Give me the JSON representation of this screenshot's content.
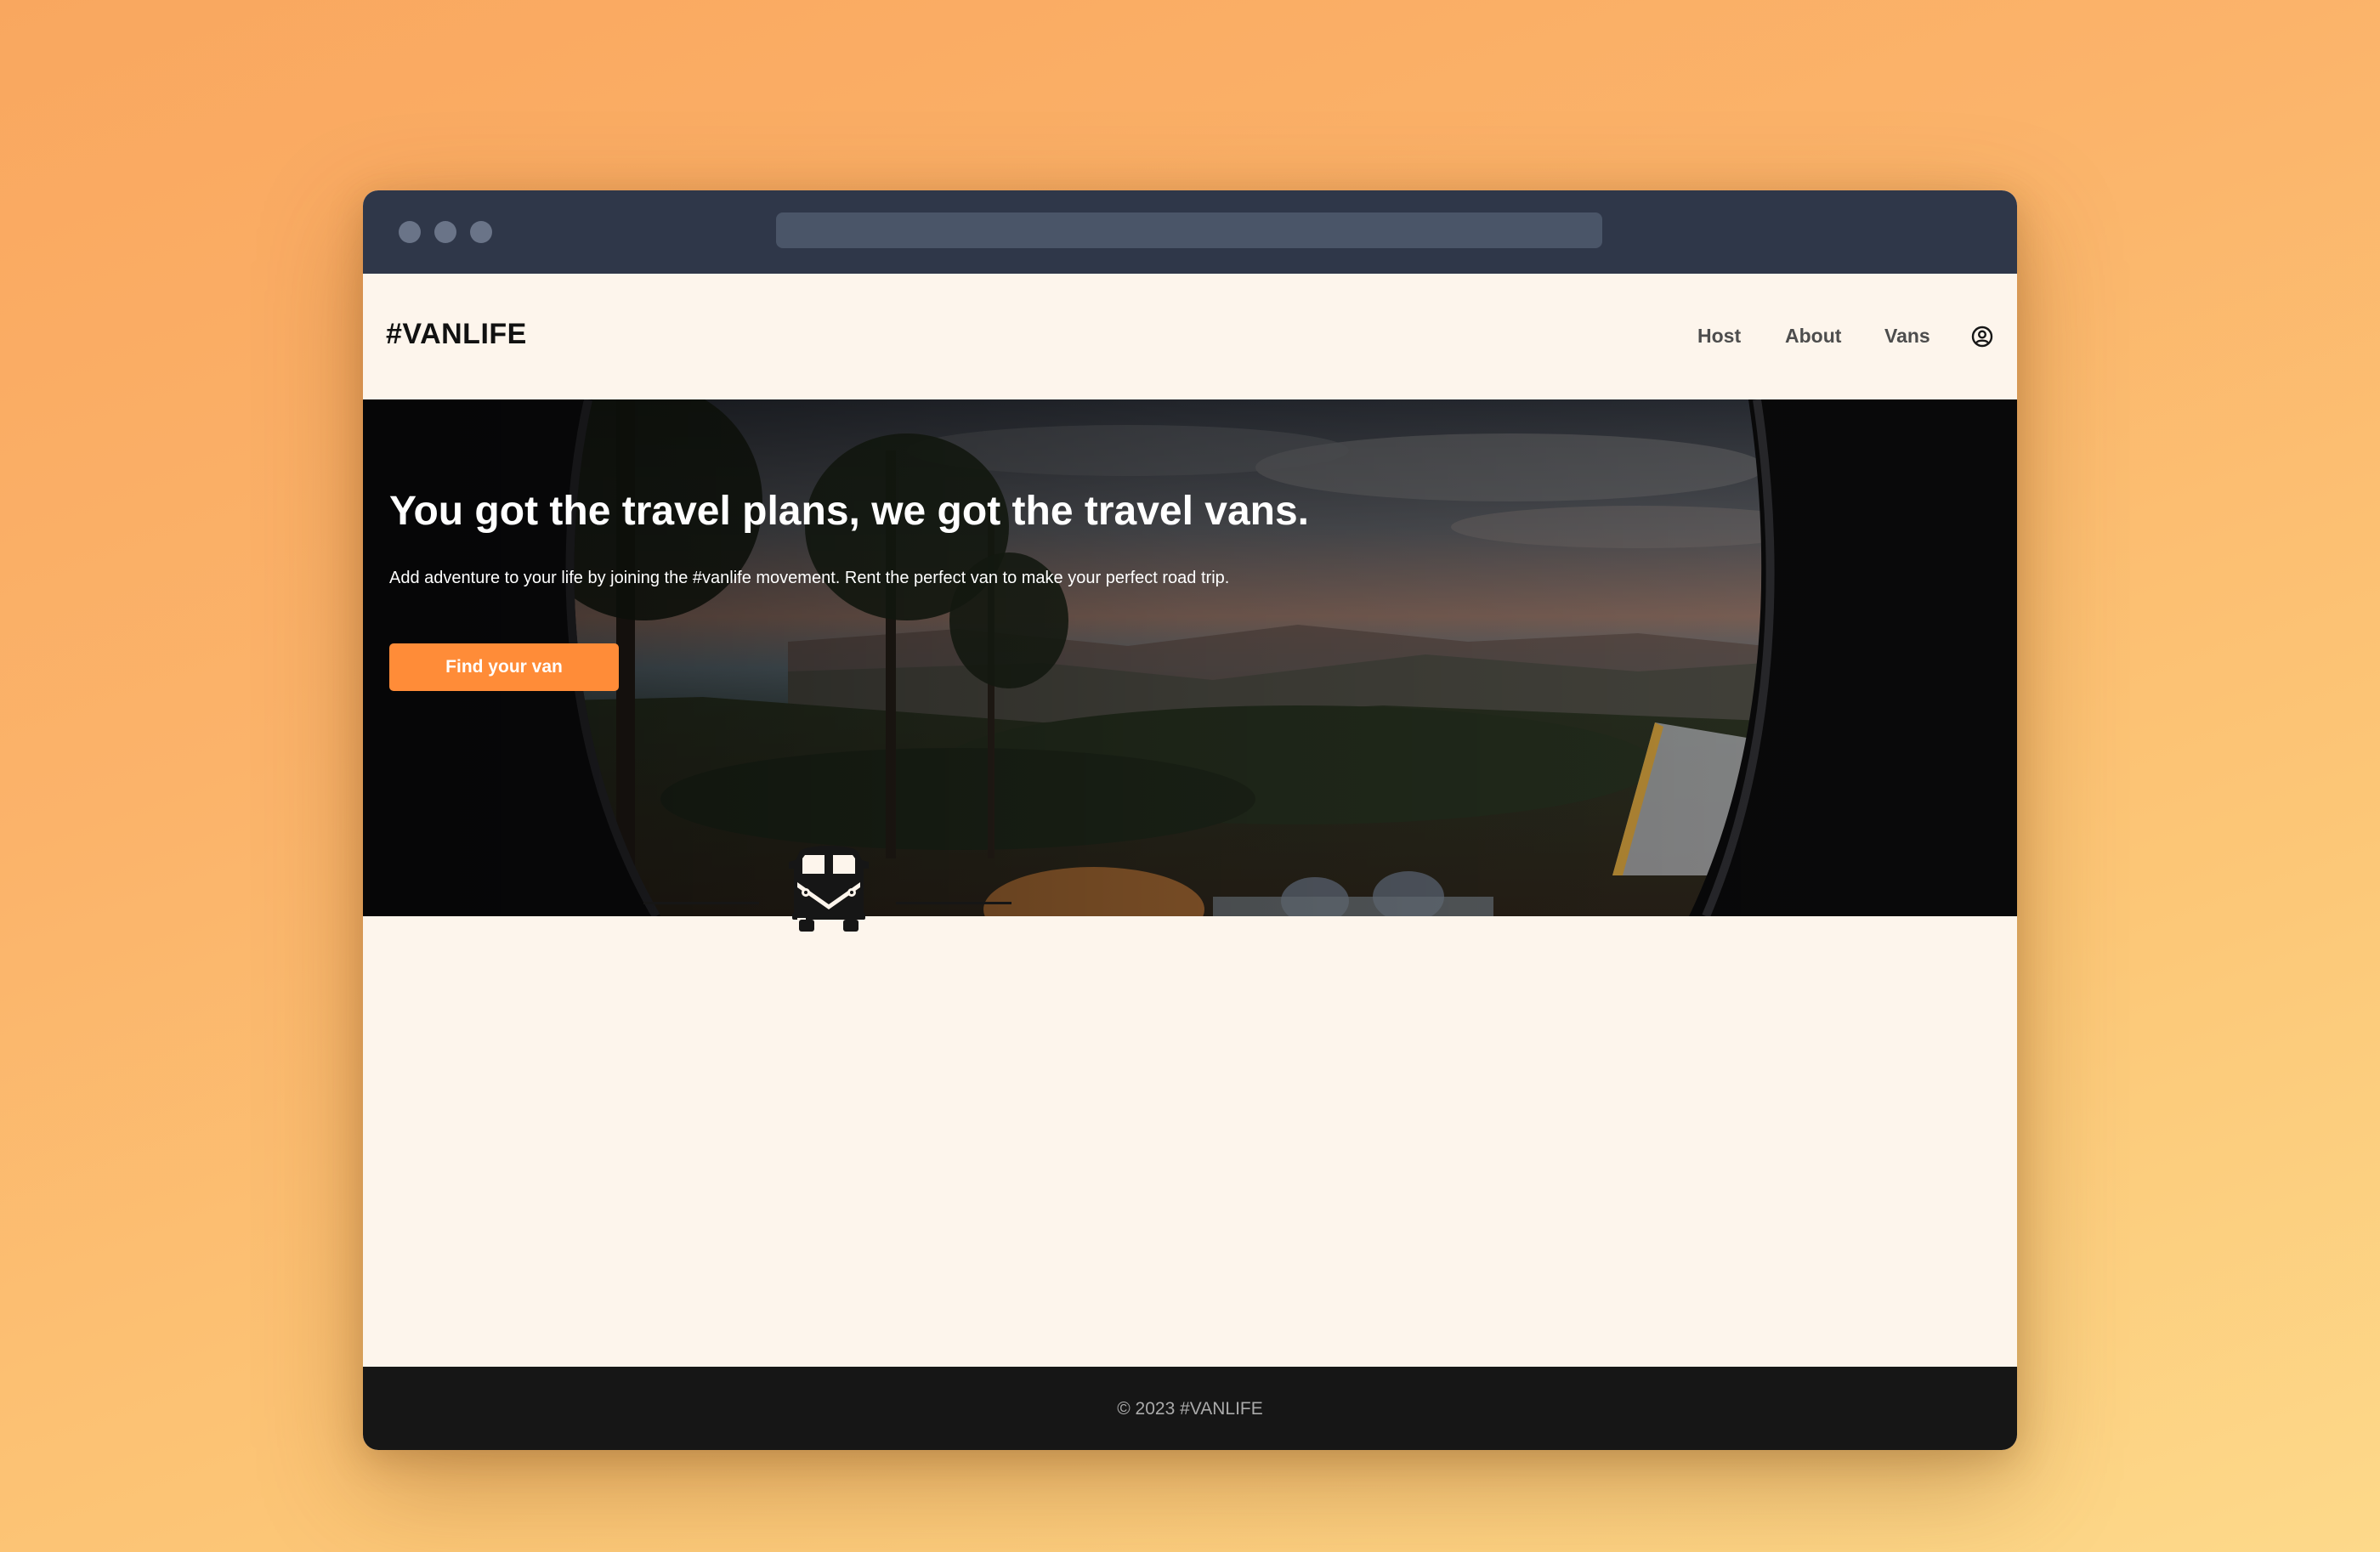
{
  "browser": {
    "window_controls": [
      "close",
      "minimize",
      "maximize"
    ],
    "address_bar_value": ""
  },
  "navbar": {
    "logo": "#VANLIFE",
    "links": [
      {
        "label": "Host"
      },
      {
        "label": "About"
      },
      {
        "label": "Vans"
      }
    ],
    "user_icon": "user-circle-icon"
  },
  "hero": {
    "title": "You got the travel plans, we got the travel vans.",
    "subtitle": "Add adventure to your life by joining the #vanlife movement. Rent the perfect van to make your perfect road trip.",
    "cta_label": "Find your van",
    "background_image": "view-from-open-van-of-forest-canyon-at-sunset"
  },
  "content": {
    "icon": "camper-van-icon"
  },
  "footer": {
    "text": "© 2023 #VANLIFE"
  },
  "colors": {
    "accent": "#ff8c38",
    "page_bg": "#fdf5ec",
    "footer_bg": "#161616",
    "titlebar_bg": "#2f3749"
  }
}
